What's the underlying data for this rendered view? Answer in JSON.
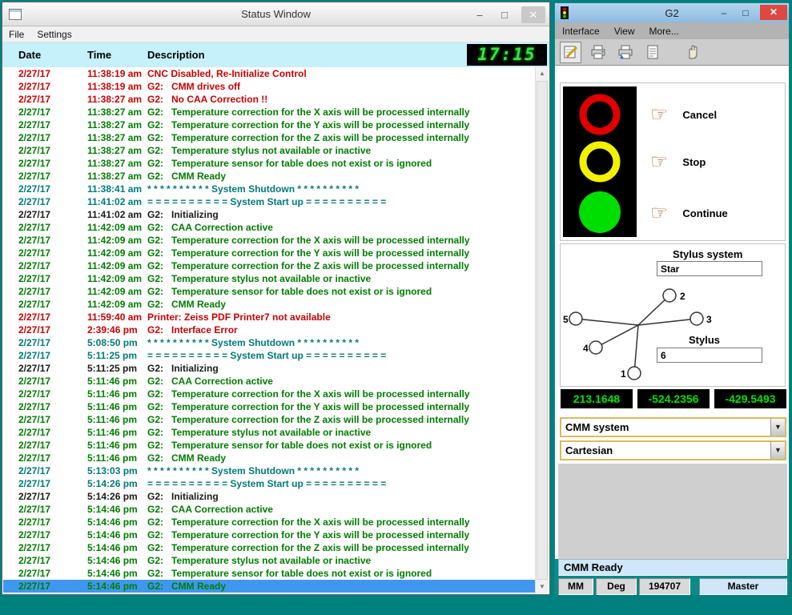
{
  "colors": {
    "desktop": "#00807f",
    "log_red": "#cc0000",
    "log_green": "#007d00",
    "log_teal": "#007a7a",
    "selection_blue": "#4097f0",
    "led_green": "#35e83a",
    "coord_green": "#00e400"
  },
  "icons": {
    "minimize": "–",
    "maximize": "□",
    "close": "✕",
    "scroll_up": "▲",
    "scroll_down": "▼",
    "dropdown_arrow": "▼",
    "hand": "☞"
  },
  "status_window": {
    "title": "Status Window",
    "menu": [
      "File",
      "Settings"
    ],
    "columns": {
      "date": "Date",
      "time": "Time",
      "desc": "Description"
    },
    "clock": "17:15",
    "rows": [
      {
        "date": "2/27/17",
        "time": "11:38:19 am",
        "desc": "CNC Disabled, Re-Initialize Control",
        "color": "red"
      },
      {
        "date": "2/27/17",
        "time": "11:38:19 am",
        "desc": "G2:   CMM drives off",
        "color": "red"
      },
      {
        "date": "2/27/17",
        "time": "11:38:27 am",
        "desc": "G2:   No CAA Correction !!",
        "color": "red"
      },
      {
        "date": "2/27/17",
        "time": "11:38:27 am",
        "desc": "G2:   Temperature correction for the X axis will be processed internally",
        "color": "green"
      },
      {
        "date": "2/27/17",
        "time": "11:38:27 am",
        "desc": "G2:   Temperature correction for the Y axis will be processed internally",
        "color": "green"
      },
      {
        "date": "2/27/17",
        "time": "11:38:27 am",
        "desc": "G2:   Temperature correction for the Z axis will be processed internally",
        "color": "green"
      },
      {
        "date": "2/27/17",
        "time": "11:38:27 am",
        "desc": "G2:   Temperature stylus not available or inactive",
        "color": "green"
      },
      {
        "date": "2/27/17",
        "time": "11:38:27 am",
        "desc": "G2:   Temperature sensor for table does not exist or is ignored",
        "color": "green"
      },
      {
        "date": "2/27/17",
        "time": "11:38:27 am",
        "desc": "G2:   CMM Ready",
        "color": "green"
      },
      {
        "date": "2/27/17",
        "time": "11:38:41 am",
        "desc": "* * * * * * * * * * System Shutdown * * * * * * * * * *",
        "color": "teal"
      },
      {
        "date": "2/27/17",
        "time": "11:41:02 am",
        "desc": "= = = = = = = = = = System Start up = = = = = = = = = =",
        "color": "teal"
      },
      {
        "date": "2/27/17",
        "time": "11:41:02 am",
        "desc": "G2:   Initializing",
        "color": "black"
      },
      {
        "date": "2/27/17",
        "time": "11:42:09 am",
        "desc": "G2:   CAA Correction active",
        "color": "green"
      },
      {
        "date": "2/27/17",
        "time": "11:42:09 am",
        "desc": "G2:   Temperature correction for the X axis will be processed internally",
        "color": "green"
      },
      {
        "date": "2/27/17",
        "time": "11:42:09 am",
        "desc": "G2:   Temperature correction for the Y axis will be processed internally",
        "color": "green"
      },
      {
        "date": "2/27/17",
        "time": "11:42:09 am",
        "desc": "G2:   Temperature correction for the Z axis will be processed internally",
        "color": "green"
      },
      {
        "date": "2/27/17",
        "time": "11:42:09 am",
        "desc": "G2:   Temperature stylus not available or inactive",
        "color": "green"
      },
      {
        "date": "2/27/17",
        "time": "11:42:09 am",
        "desc": "G2:   Temperature sensor for table does not exist or is ignored",
        "color": "green"
      },
      {
        "date": "2/27/17",
        "time": "11:42:09 am",
        "desc": "G2:   CMM Ready",
        "color": "green"
      },
      {
        "date": "2/27/17",
        "time": "11:59:40 am",
        "desc": "Printer: Zeiss PDF Printer7 not available",
        "color": "red"
      },
      {
        "date": "2/27/17",
        "time": "2:39:46 pm",
        "desc": "G2:   Interface Error",
        "color": "red"
      },
      {
        "date": "2/27/17",
        "time": "5:08:50 pm",
        "desc": "* * * * * * * * * * System Shutdown * * * * * * * * * *",
        "color": "teal"
      },
      {
        "date": "2/27/17",
        "time": "5:11:25 pm",
        "desc": "= = = = = = = = = = System Start up = = = = = = = = = =",
        "color": "teal"
      },
      {
        "date": "2/27/17",
        "time": "5:11:25 pm",
        "desc": "G2:   Initializing",
        "color": "black"
      },
      {
        "date": "2/27/17",
        "time": "5:11:46 pm",
        "desc": "G2:   CAA Correction active",
        "color": "green"
      },
      {
        "date": "2/27/17",
        "time": "5:11:46 pm",
        "desc": "G2:   Temperature correction for the X axis will be processed internally",
        "color": "green"
      },
      {
        "date": "2/27/17",
        "time": "5:11:46 pm",
        "desc": "G2:   Temperature correction for the Y axis will be processed internally",
        "color": "green"
      },
      {
        "date": "2/27/17",
        "time": "5:11:46 pm",
        "desc": "G2:   Temperature correction for the Z axis will be processed internally",
        "color": "green"
      },
      {
        "date": "2/27/17",
        "time": "5:11:46 pm",
        "desc": "G2:   Temperature stylus not available or inactive",
        "color": "green"
      },
      {
        "date": "2/27/17",
        "time": "5:11:46 pm",
        "desc": "G2:   Temperature sensor for table does not exist or is ignored",
        "color": "green"
      },
      {
        "date": "2/27/17",
        "time": "5:11:46 pm",
        "desc": "G2:   CMM Ready",
        "color": "green"
      },
      {
        "date": "2/27/17",
        "time": "5:13:03 pm",
        "desc": "* * * * * * * * * * System Shutdown * * * * * * * * * *",
        "color": "teal"
      },
      {
        "date": "2/27/17",
        "time": "5:14:26 pm",
        "desc": "= = = = = = = = = = System Start up = = = = = = = = = =",
        "color": "teal"
      },
      {
        "date": "2/27/17",
        "time": "5:14:26 pm",
        "desc": "G2:   Initializing",
        "color": "black"
      },
      {
        "date": "2/27/17",
        "time": "5:14:46 pm",
        "desc": "G2:   CAA Correction active",
        "color": "green"
      },
      {
        "date": "2/27/17",
        "time": "5:14:46 pm",
        "desc": "G2:   Temperature correction for the X axis will be processed internally",
        "color": "green"
      },
      {
        "date": "2/27/17",
        "time": "5:14:46 pm",
        "desc": "G2:   Temperature correction for the Y axis will be processed internally",
        "color": "green"
      },
      {
        "date": "2/27/17",
        "time": "5:14:46 pm",
        "desc": "G2:   Temperature correction for the Z axis will be processed internally",
        "color": "green"
      },
      {
        "date": "2/27/17",
        "time": "5:14:46 pm",
        "desc": "G2:   Temperature stylus not available or inactive",
        "color": "green"
      },
      {
        "date": "2/27/17",
        "time": "5:14:46 pm",
        "desc": "G2:   Temperature sensor for table does not exist or is ignored",
        "color": "green"
      },
      {
        "date": "2/27/17",
        "time": "5:14:46 pm",
        "desc": "G2:   CMM Ready",
        "color": "green",
        "selected": true
      }
    ]
  },
  "g2_window": {
    "title": "G2",
    "menu": [
      "Interface",
      "View",
      "More..."
    ],
    "traffic_buttons": [
      {
        "label": "Cancel"
      },
      {
        "label": "Stop"
      },
      {
        "label": "Continue"
      }
    ],
    "stylus": {
      "system_label": "Stylus system",
      "system_value": "Star",
      "label": "Stylus",
      "value": "6",
      "positions": [
        "1",
        "2",
        "3",
        "4",
        "5"
      ]
    },
    "coordinates": [
      "213.1648",
      "-524.2356",
      "-429.5493"
    ],
    "dropdowns": [
      "CMM system",
      "Cartesian"
    ],
    "status_text": "CMM Ready",
    "statusbar": [
      "MM",
      "Deg",
      "194707",
      "Master"
    ]
  }
}
